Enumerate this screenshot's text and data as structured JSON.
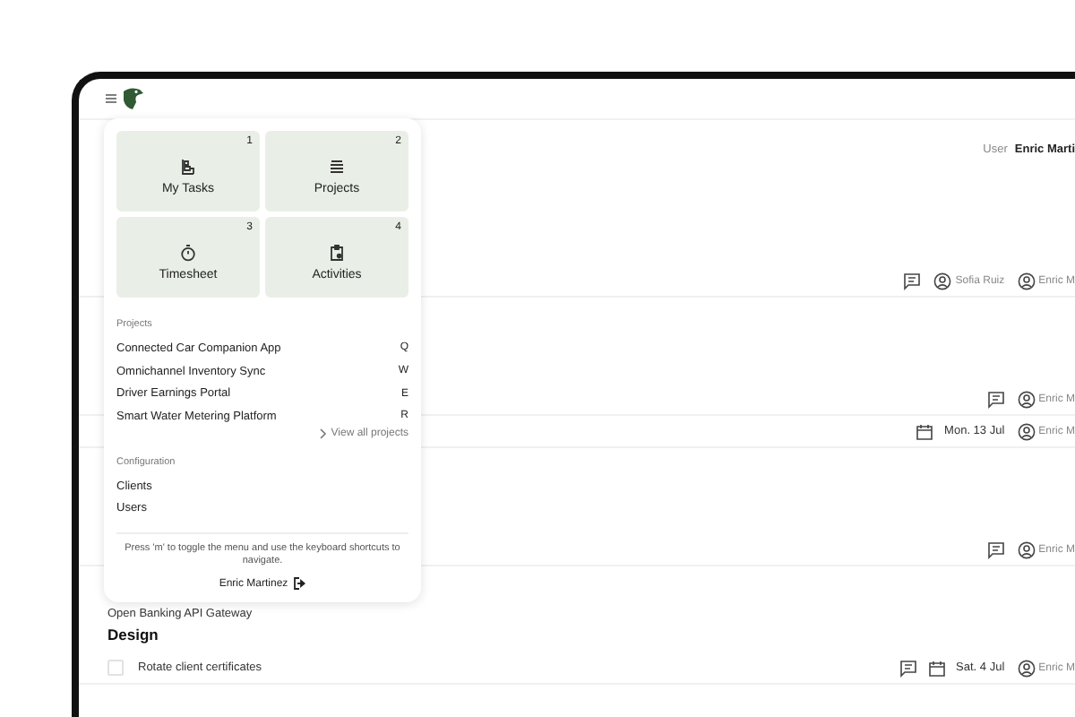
{
  "header": {
    "user_label": "User",
    "user_name": "Enric Marti"
  },
  "menu": {
    "tiles": [
      {
        "label": "My Tasks",
        "key": "1",
        "kind": "tasks"
      },
      {
        "label": "Projects",
        "key": "2",
        "kind": "projects"
      },
      {
        "label": "Timesheet",
        "key": "3",
        "kind": "timer"
      },
      {
        "label": "Activities",
        "key": "4",
        "kind": "activities"
      }
    ],
    "projects_heading": "Projects",
    "projects": [
      {
        "name": "Connected Car Companion App",
        "key": "Q"
      },
      {
        "name": "Omnichannel Inventory Sync",
        "key": "W"
      },
      {
        "name": "Driver Earnings Portal",
        "key": "E"
      },
      {
        "name": "Smart Water Metering Platform",
        "key": "R"
      }
    ],
    "view_all": "View all projects",
    "configuration_heading": "Configuration",
    "configuration": [
      "Clients",
      "Users"
    ],
    "hint": "Press 'm' to toggle the menu and use the keyboard shortcuts to navigate.",
    "user": "Enric Martinez"
  },
  "groups": [
    {
      "tasks": [
        {
          "comments": true,
          "assignees": [
            "Sofia Ruiz",
            "Enric M"
          ]
        }
      ]
    },
    {
      "tasks": [
        {
          "comments": true,
          "assignees": [
            "Enric M"
          ]
        },
        {
          "comments": false,
          "due": "Mon. 13 Jul",
          "assignees": [
            "Enric M"
          ]
        }
      ]
    },
    {
      "tasks": [
        {
          "comments": true,
          "assignees": [
            "Enric M"
          ]
        }
      ]
    },
    {
      "project": "Open Banking API Gateway",
      "section": "Design",
      "tasks": [
        {
          "title": "Rotate client certificates",
          "checked": false,
          "comments": true,
          "due": "Sat. 4 Jul",
          "assignees": [
            "Enric M"
          ]
        }
      ]
    }
  ]
}
